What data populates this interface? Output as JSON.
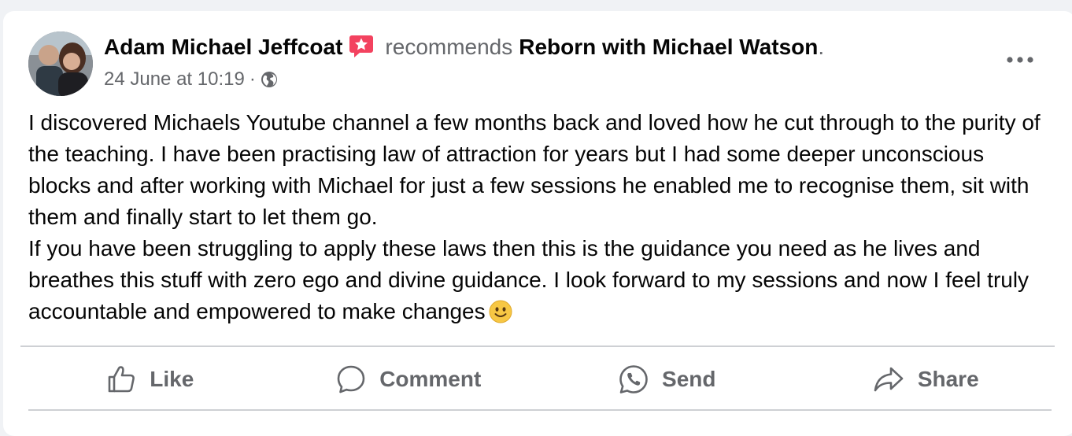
{
  "post": {
    "author": "Adam Michael Jeffcoat",
    "verb": "recommends",
    "page_name": "Reborn with Michael Watson",
    "period": ".",
    "timestamp": "24 June at 10:19",
    "separator": "·",
    "audience_icon": "globe-icon",
    "badge_icon": "recommendation-star-icon",
    "badge_color": "#f3425f",
    "paragraph_1": "I discovered Michaels Youtube channel a few months back and loved how he cut through to the purity of the teaching. I have been practising law of attraction for years but I had some deeper unconscious blocks and after working with Michael for just a few sessions he enabled me to recognise them, sit with them and finally start to let them go.",
    "paragraph_2": "If you have been struggling to apply these laws then this is the guidance you need as he lives and breathes this stuff with zero ego and divine guidance. I look forward to my sessions and now I feel truly accountable and empowered to make changes",
    "emoji": "slightly-smiling-face"
  },
  "actions": {
    "like": "Like",
    "comment": "Comment",
    "send": "Send",
    "share": "Share"
  },
  "colors": {
    "text_primary": "#050505",
    "text_secondary": "#65676b",
    "divider": "#ced0d4",
    "background": "#f0f2f5",
    "card": "#ffffff"
  }
}
